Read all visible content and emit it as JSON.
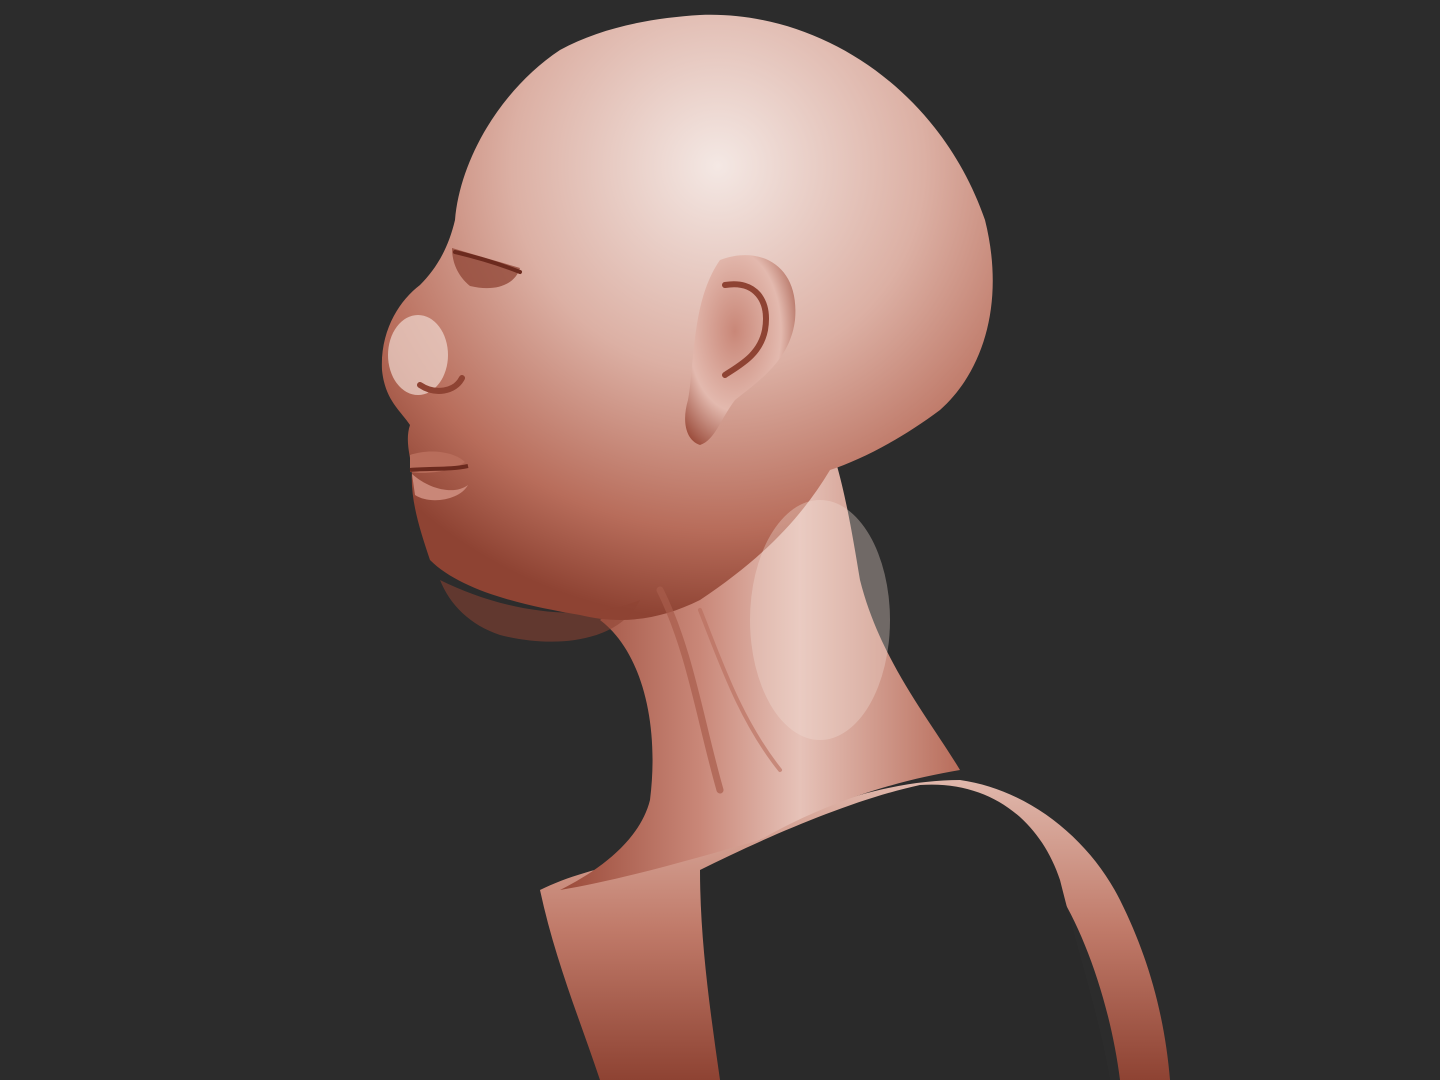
{
  "scene": {
    "subject": "sculpted-head-bust",
    "colors": {
      "background": "#2c2c2c",
      "clay_highlight": "#f2e4e0",
      "clay_light": "#e8c6bc",
      "clay_mid": "#c98778",
      "clay_dark": "#8e4333",
      "clay_deep": "#6b2a1e",
      "shadow": "#2a2a2a"
    }
  }
}
